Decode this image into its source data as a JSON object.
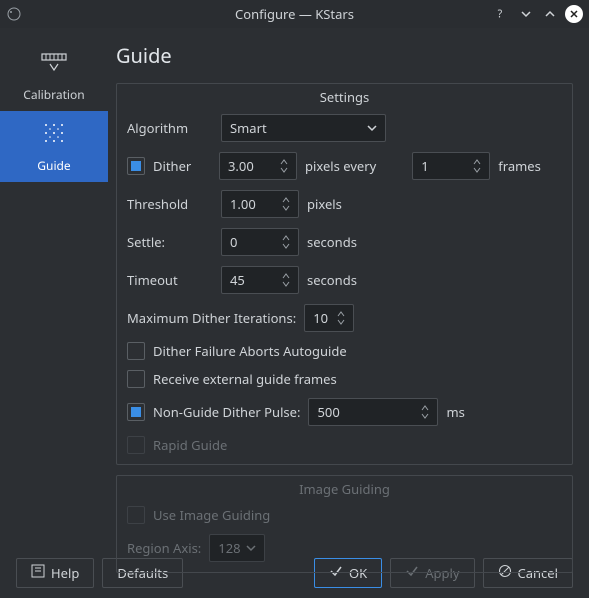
{
  "window": {
    "title": "Configure — KStars"
  },
  "sidebar": {
    "items": [
      {
        "label": "Calibration"
      },
      {
        "label": "Guide"
      }
    ],
    "activeIndex": 1
  },
  "page": {
    "title": "Guide"
  },
  "settings": {
    "legend": "Settings",
    "algorithm_label": "Algorithm",
    "algorithm_value": "Smart",
    "dither_label": "Dither",
    "dither_checked": true,
    "dither_pixels": "3.00",
    "dither_pixels_unit": "pixels every",
    "dither_frames": "1",
    "dither_frames_unit": "frames",
    "threshold_label": "Threshold",
    "threshold_value": "1.00",
    "threshold_unit": "pixels",
    "settle_label": "Settle:",
    "settle_value": "0",
    "settle_unit": "seconds",
    "timeout_label": "Timeout",
    "timeout_value": "45",
    "timeout_unit": "seconds",
    "max_dither_label": "Maximum Dither Iterations:",
    "max_dither_value": "10",
    "dither_failure_label": "Dither Failure Aborts Autoguide",
    "dither_failure_checked": false,
    "receive_external_label": "Receive external guide frames",
    "receive_external_checked": false,
    "nonguide_label": "Non-Guide Dither Pulse:",
    "nonguide_checked": true,
    "nonguide_value": "500",
    "nonguide_unit": "ms",
    "rapid_label": "Rapid Guide",
    "rapid_checked": false,
    "rapid_disabled": true
  },
  "image_guiding": {
    "legend": "Image Guiding",
    "use_label": "Use Image Guiding",
    "use_checked": false,
    "region_label": "Region Axis:",
    "region_value": "128",
    "disabled": true
  },
  "footer": {
    "help": "Help",
    "defaults": "Defaults",
    "ok": "OK",
    "apply": "Apply",
    "cancel": "Cancel"
  }
}
